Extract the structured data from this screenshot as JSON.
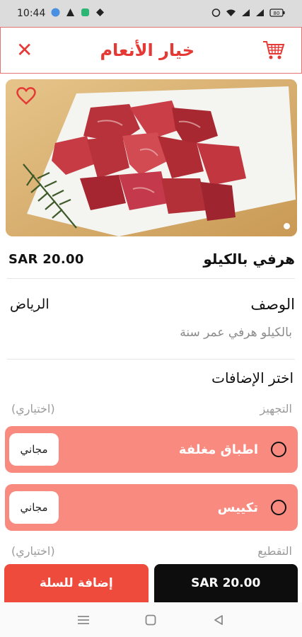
{
  "status_bar": {
    "time": "10:44",
    "icons": [
      "facebook-icon",
      "warning-icon",
      "chat-icon",
      "diamond-icon"
    ],
    "right_icons": [
      "alarm-icon",
      "wifi-icon",
      "signal-icon",
      "signal-icon",
      "battery-icon"
    ],
    "battery": "80"
  },
  "header": {
    "title": "خيار الأنعام",
    "close_icon": "close-icon",
    "cart_icon": "cart-icon",
    "accent_color": "#e53935"
  },
  "product": {
    "image": "meat-cubes-photo",
    "favorite_icon": "heart-icon",
    "name": "هرفي بالكيلو",
    "price": "SAR 20.00",
    "image_pages": 1,
    "current_page": 1
  },
  "description": {
    "title": "الوصف",
    "city": "الرياض",
    "text": "بالكيلو هرفي عمر سنة"
  },
  "addons": {
    "title": "اختر الإضافات",
    "groups": [
      {
        "name": "التجهيز",
        "optional": "(اختياري)",
        "options": [
          {
            "label": "اطباق مغلفة",
            "badge": "مجاني",
            "selected": false
          },
          {
            "label": "تكييس",
            "badge": "مجاني",
            "selected": false
          }
        ]
      },
      {
        "name": "التقطيع",
        "optional": "(اختياري)",
        "options": []
      }
    ]
  },
  "bottom": {
    "add_to_cart": "إضافة للسلة",
    "total": "SAR 20.00"
  },
  "nav": {
    "items": [
      "menu-icon",
      "home-icon",
      "back-icon"
    ]
  }
}
